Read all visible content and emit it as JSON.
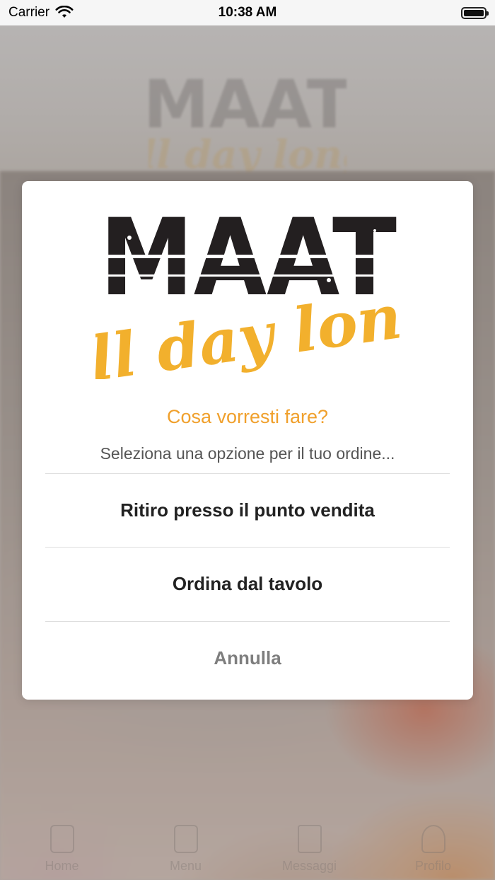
{
  "status_bar": {
    "carrier": "Carrier",
    "time": "10:38 AM",
    "battery_level": 1.0
  },
  "background": {
    "brand": {
      "logo_word": "MAAT",
      "logo_script": "All day long"
    },
    "tabbar": {
      "items": [
        {
          "label": "Home",
          "icon": "home-icon"
        },
        {
          "label": "Menu",
          "icon": "menu-icon"
        },
        {
          "label": "Messaggi",
          "icon": "chat-icon"
        },
        {
          "label": "Profilo",
          "icon": "user-icon"
        }
      ]
    }
  },
  "dialog": {
    "logo": {
      "word": "MAAT",
      "script": "All day long"
    },
    "title": "Cosa vorresti fare?",
    "message": "Seleziona una opzione per il tuo ordine...",
    "options": [
      {
        "label": "Ritiro presso il punto vendita"
      },
      {
        "label": "Ordina dal tavolo"
      }
    ],
    "cancel_label": "Annulla"
  },
  "colors": {
    "accent": "#f0a02c",
    "logo_dark": "#231f20",
    "logo_yellow": "#f2b02d"
  }
}
